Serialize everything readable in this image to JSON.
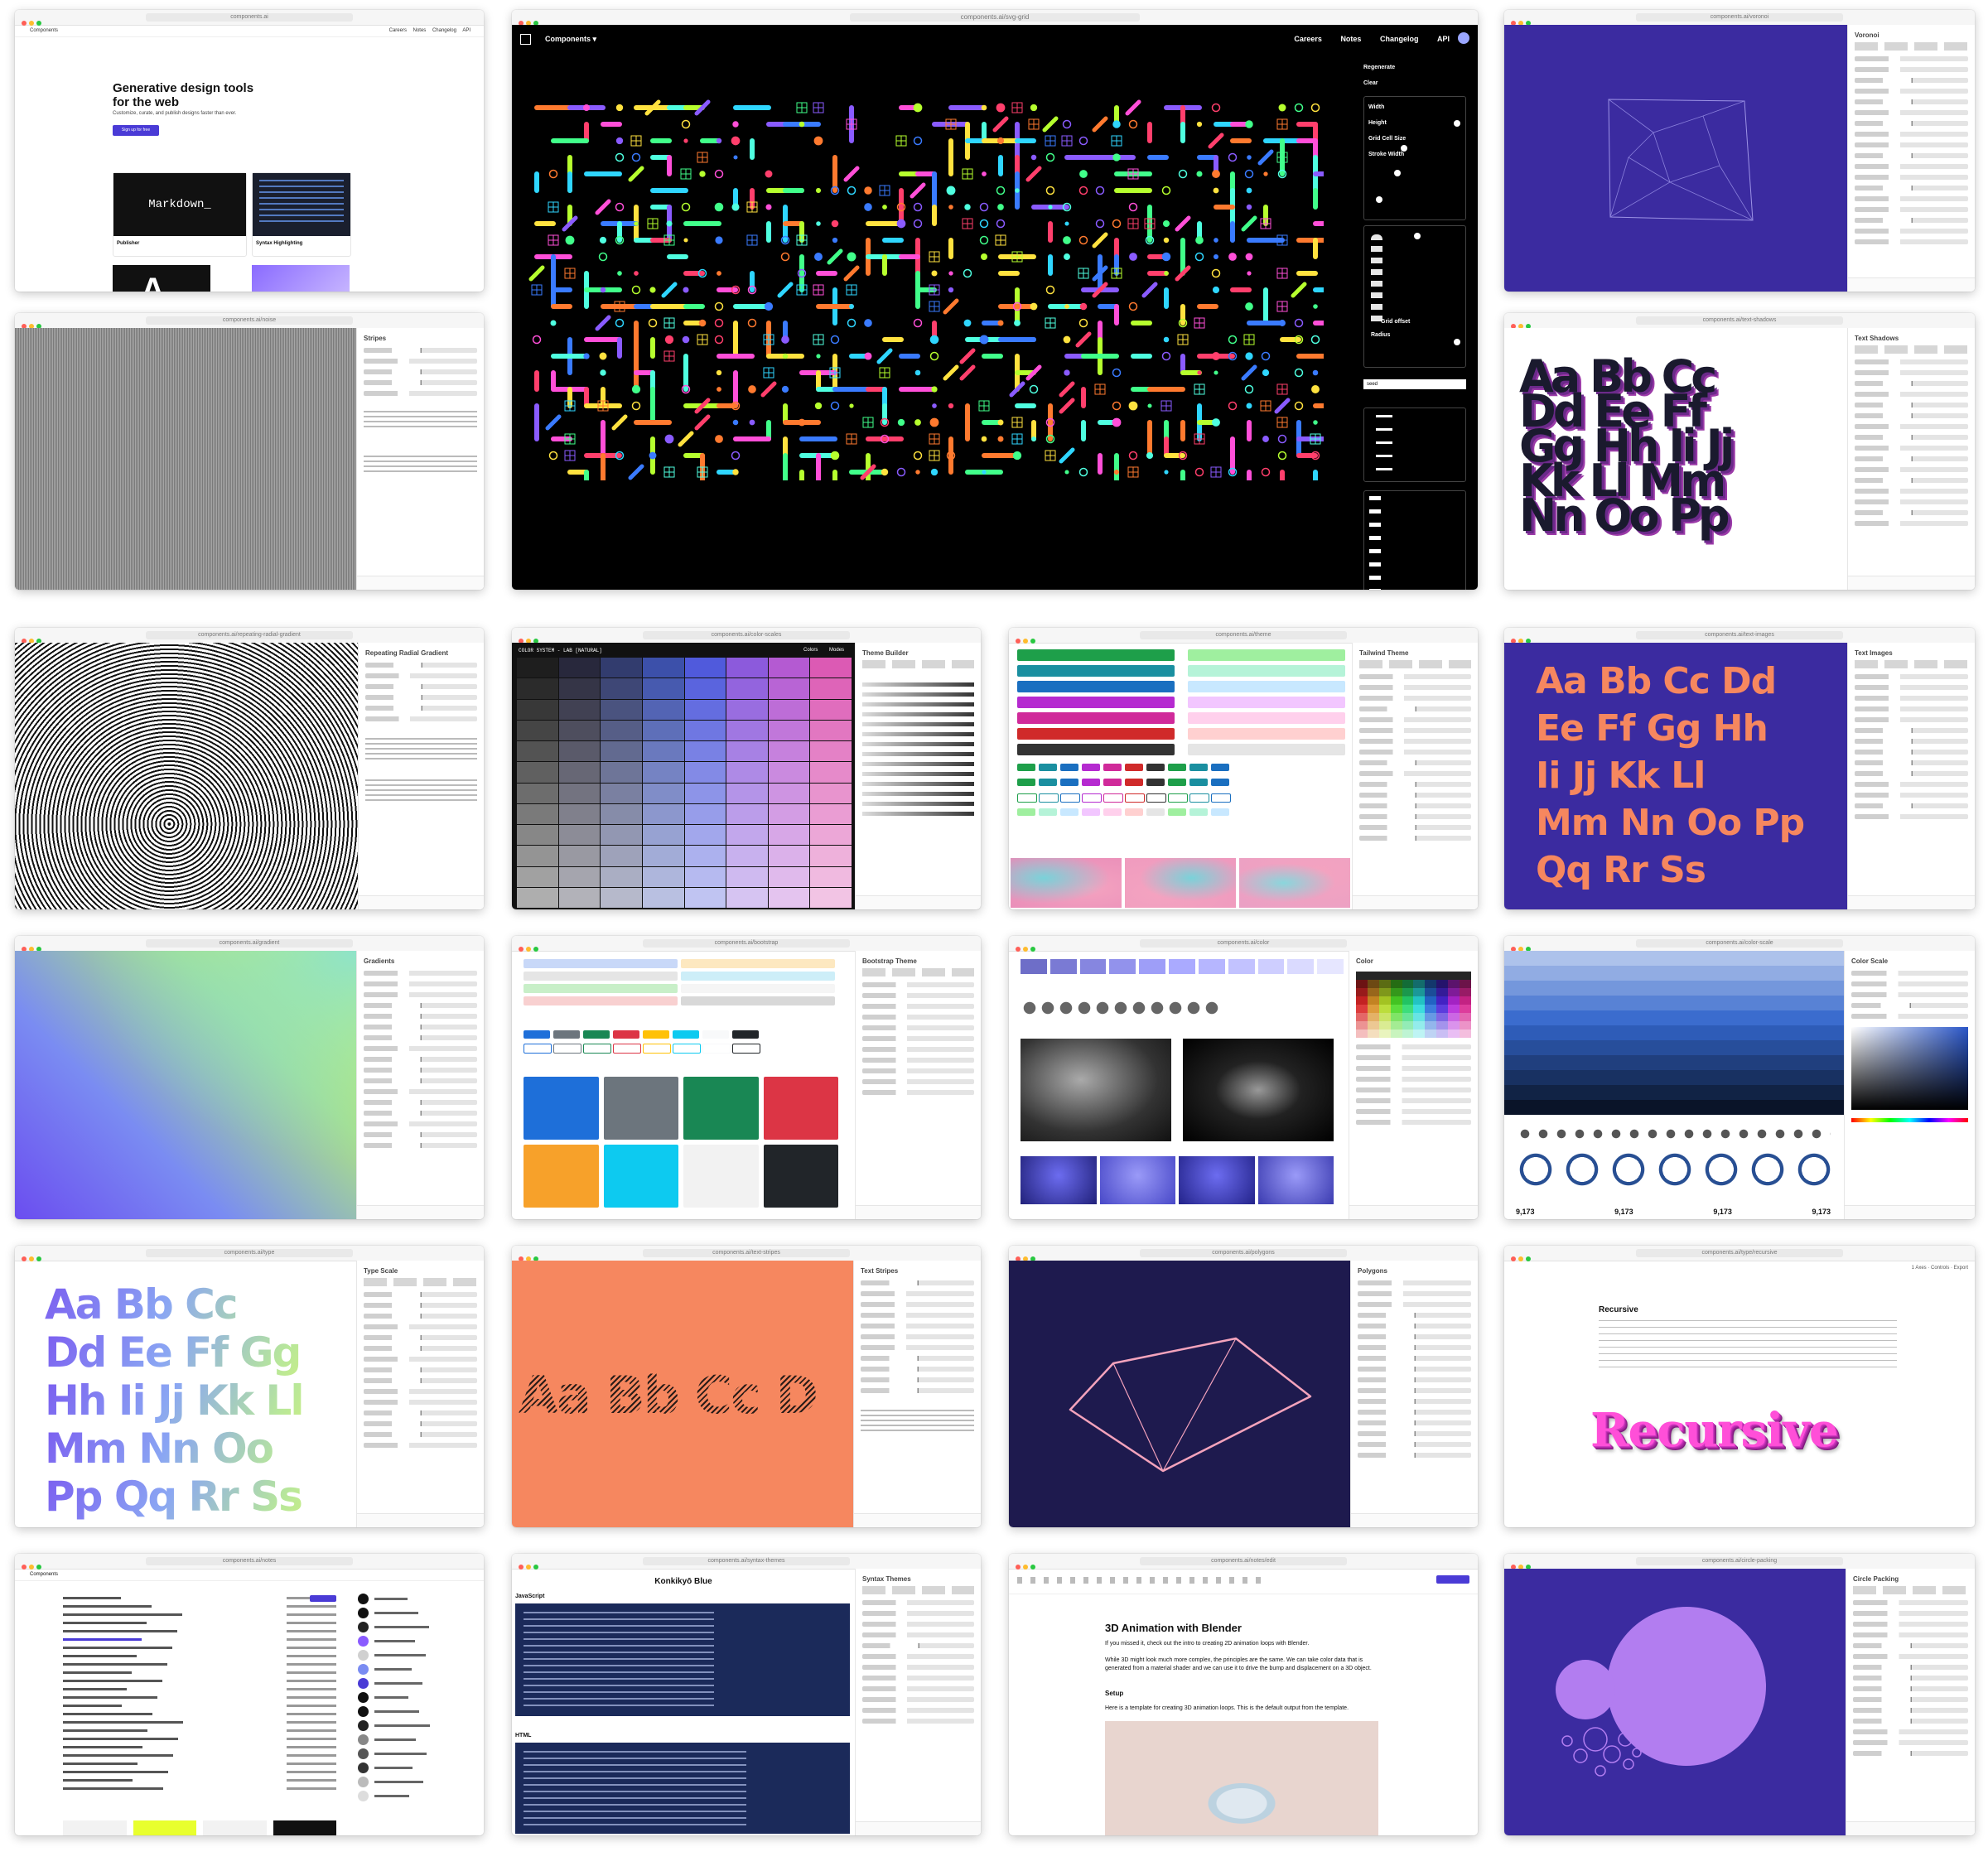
{
  "hero": {
    "headline": "Generative design tools for the web",
    "tagline": "Customize, curate, and publish designs faster than ever.",
    "cta": "Sign up for free",
    "card1_name": "Markdown_",
    "card1_label": "Publisher",
    "card2_label": "Syntax Highlighting",
    "card3_letter": "A"
  },
  "main_window": {
    "address": "components.ai/svg-grid",
    "brand": "Components",
    "nav": [
      "Careers",
      "Notes",
      "Changelog",
      "API"
    ],
    "actions": [
      "Regenerate",
      "Clear"
    ],
    "controls": [
      "Width",
      "Height",
      "Grid Cell Size",
      "Stroke Width"
    ],
    "grid_offset": "Grid offset",
    "radius": "Radius",
    "seed_placeholder": "seed"
  },
  "typography": {
    "tile_letters": [
      "Aa Bb Cc",
      "Dd Ee Ff",
      "Gg Hh Ii Jj",
      "Kk Ll Mm",
      "Nn Oo Pp"
    ],
    "purple_letters": [
      "Aa Bb Cc Dd",
      "Ee Ff Gg Hh",
      "Ii Jj Kk Ll",
      "Mm Nn Oo Pp",
      "Qq Rr Ss"
    ],
    "gradient_letters": [
      "Aa Bb Cc",
      "Dd Ee Ff Gg",
      "Hh Ii Jj Kk Ll",
      "Mm Nn Oo",
      "Pp Qq Rr Ss"
    ],
    "striped_letters": "Aa Bb Cc D",
    "recursive_title": "Recursive",
    "recursive_word": "Recursive"
  },
  "color_system": {
    "title": "COLOR SYSTEM - LAB [NATURAL]",
    "tabs": [
      "Colors",
      "Modes"
    ]
  },
  "stats": {
    "value": "9,173"
  },
  "pages": {
    "konkikyo": "Konkikyō Blue",
    "javascript": "JavaScript",
    "html": "HTML",
    "blender_title": "3D Animation with Blender",
    "blender_p1": "If you missed it, check out the intro to creating 2D animation loops with Blender.",
    "blender_p2": "While 3D might look much more complex, the principles are the same. We can take color data that is generated from a material shader and we can use it to drive the bump and displacement on a 3D object.",
    "blender_setup": "Setup",
    "blender_p3": "Here is a template for creating 3D animation loops. This is the default output from the template."
  },
  "colors": {
    "nav_bg": "#000000",
    "deep_purple": "#3b2ba0",
    "navy": "#1e1a4e",
    "orange": "#f6875f",
    "lilac": "#b27df0",
    "accent_blue": "#4a3bd6"
  }
}
